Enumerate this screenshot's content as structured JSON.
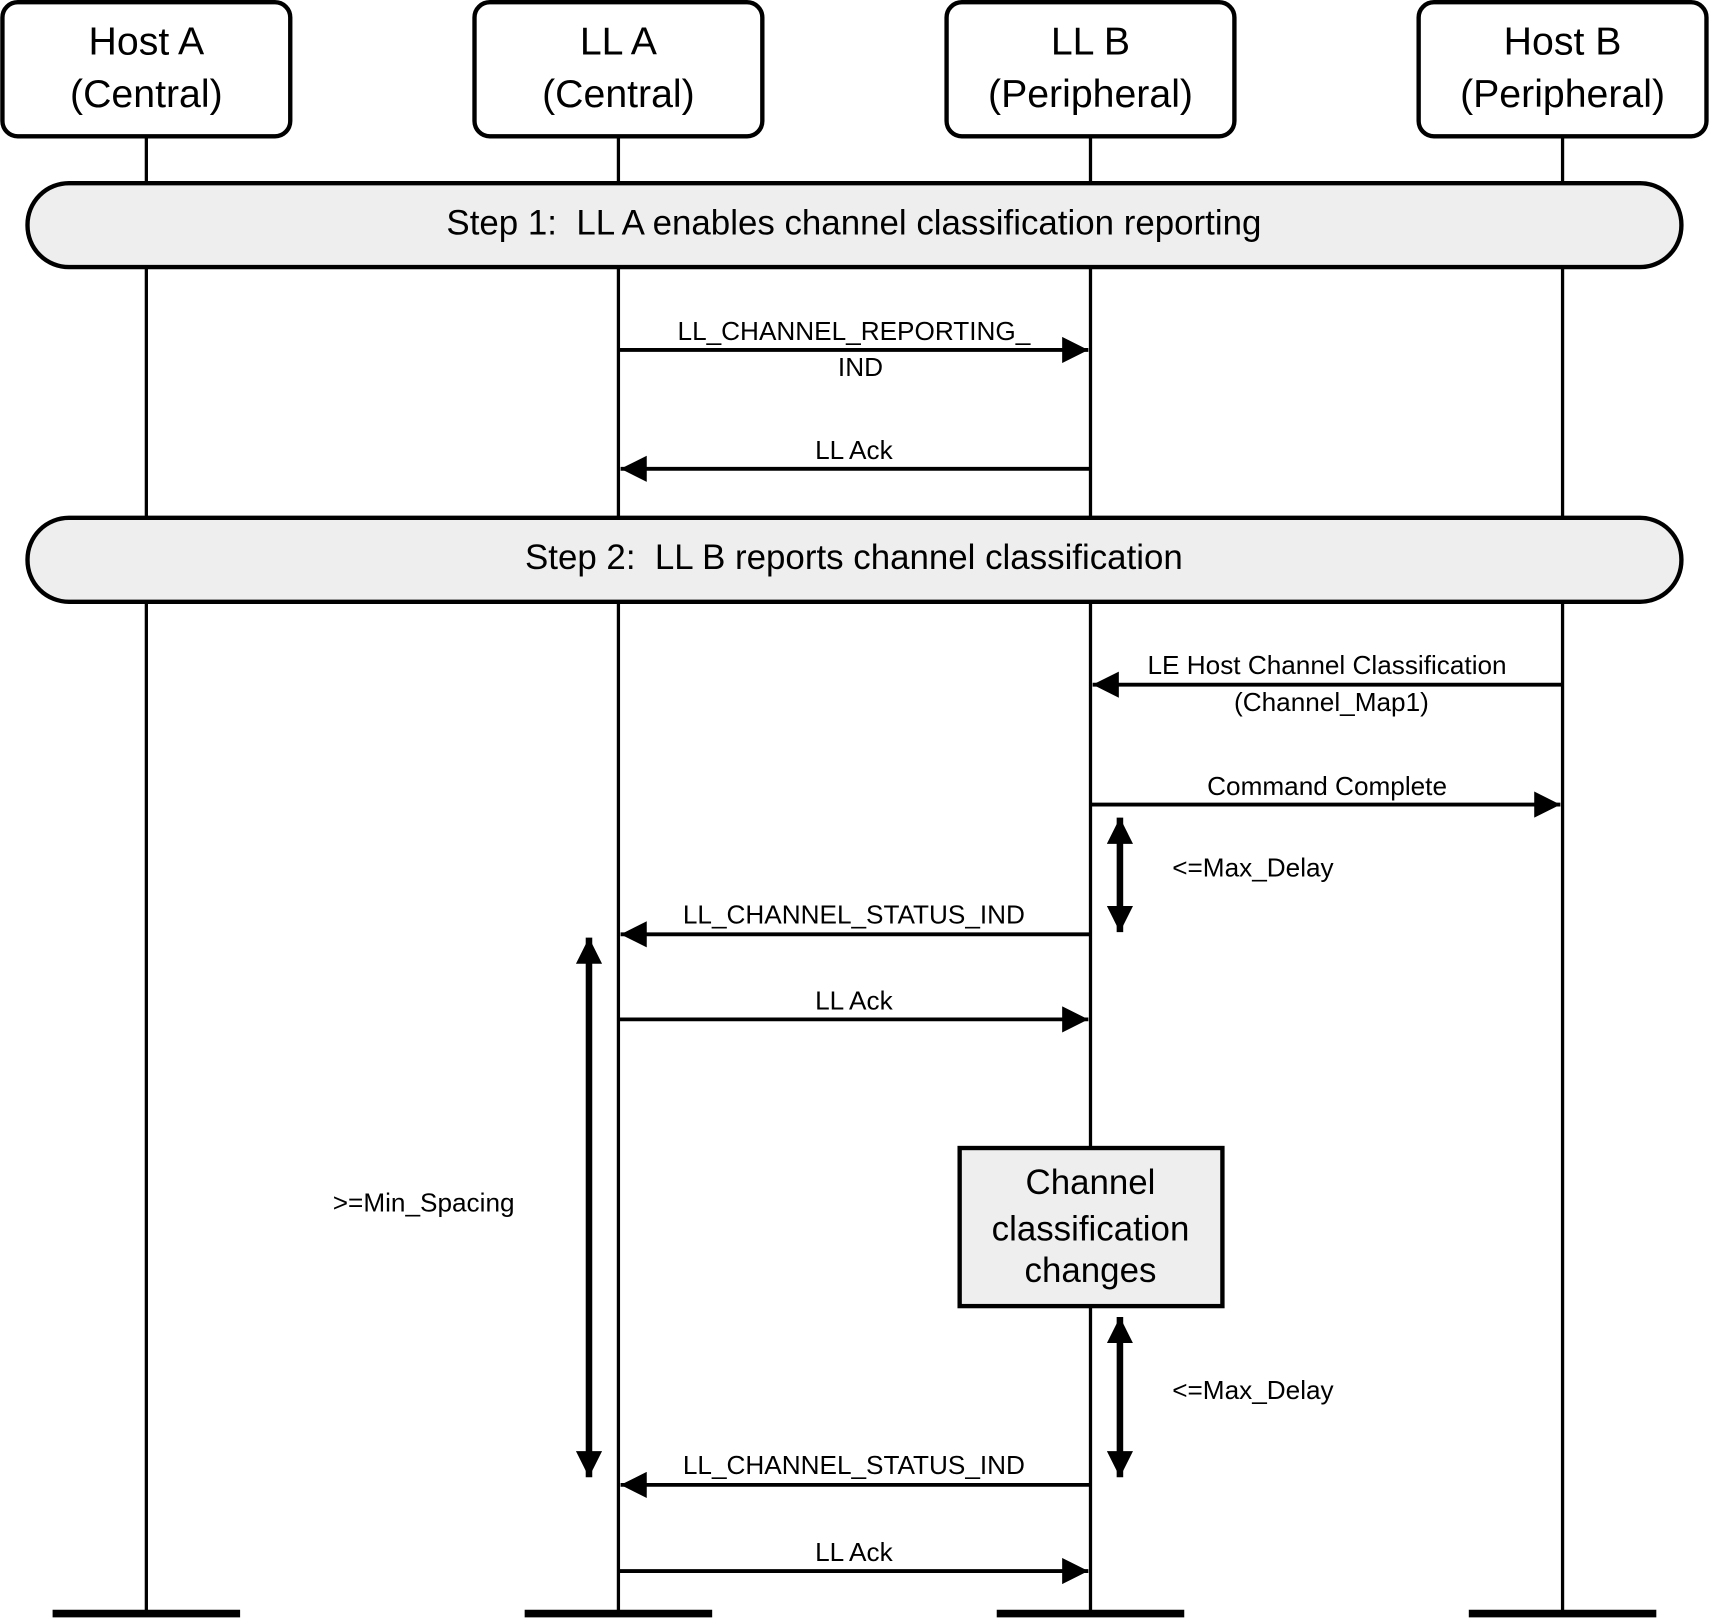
{
  "participants": [
    {
      "name": "Host A",
      "role": "(Central)"
    },
    {
      "name": "LL A",
      "role": "(Central)"
    },
    {
      "name": "LL B",
      "role": "(Peripheral)"
    },
    {
      "name": "Host B",
      "role": "(Peripheral)"
    }
  ],
  "steps": [
    {
      "label": "Step 1:  LL A enables channel classification reporting"
    },
    {
      "label": "Step 2:  LL B reports channel classification"
    }
  ],
  "messages": [
    {
      "from": "LL A",
      "to": "LL B",
      "line1": "LL_CHANNEL_REPORTING_",
      "line2": "IND"
    },
    {
      "from": "LL B",
      "to": "LL A",
      "line1": "LL Ack"
    },
    {
      "from": "Host B",
      "to": "LL B",
      "line1": "LE Host Channel Classification",
      "line2": "(Channel_Map1)"
    },
    {
      "from": "LL B",
      "to": "Host B",
      "line1": "Command Complete"
    },
    {
      "from": "LL B",
      "to": "LL A",
      "line1": "LL_CHANNEL_STATUS_IND"
    },
    {
      "from": "LL A",
      "to": "LL B",
      "line1": "LL Ack"
    },
    {
      "from": "LL B",
      "to": "LL A",
      "line1": "LL_CHANNEL_STATUS_IND"
    },
    {
      "from": "LL A",
      "to": "LL B",
      "line1": "LL Ack"
    }
  ],
  "timing": {
    "max_delay_1": "<=Max_Delay",
    "max_delay_2": "<=Max_Delay",
    "min_spacing": ">=Min_Spacing"
  },
  "event_box": {
    "line1": "Channel",
    "line2": "classification",
    "line3": "changes"
  },
  "colors": {
    "step_fill": "#eeeeee",
    "line": "#000000"
  }
}
